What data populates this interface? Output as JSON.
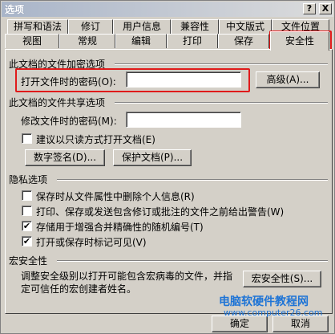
{
  "window": {
    "title": "选项",
    "help_btn": "?",
    "close_btn": "X"
  },
  "tabs_row1": [
    "拼写和语法",
    "修订",
    "用户信息",
    "兼容性",
    "中文版式",
    "文件位置"
  ],
  "tabs_row2": [
    "视图",
    "常规",
    "编辑",
    "打印",
    "保存",
    "安全性"
  ],
  "encryption": {
    "title": "此文档的文件加密选项",
    "open_password_label": "打开文件时的密码(O):",
    "open_password_value": "",
    "advanced_btn": "高级(A)..."
  },
  "sharing": {
    "title": "此文档的文件共享选项",
    "modify_password_label": "修改文件时的密码(M):",
    "modify_password_value": "",
    "readonly_label": "建议以只读方式打开文档(E)",
    "readonly_checked": false,
    "digital_signature_btn": "数字签名(D)...",
    "protect_doc_btn": "保护文档(P)..."
  },
  "privacy": {
    "title": "隐私选项",
    "items": [
      {
        "label": "保存时从文件属性中删除个人信息(R)",
        "checked": false
      },
      {
        "label": "打印、保存或发送包含修订或批注的文件之前给出警告(W)",
        "checked": false
      },
      {
        "label": "存储用于增强合并精确性的随机编号(T)",
        "checked": true
      },
      {
        "label": "打开或保存时标记可见(V)",
        "checked": true
      }
    ]
  },
  "macro": {
    "title": "宏安全性",
    "description_line1": "调整安全级别以打开可能包含宏病毒的文件，并指",
    "description_line2": "定可信任的宏创建者姓名。",
    "macro_security_btn": "宏安全性(S)..."
  },
  "footer": {
    "ok_btn": "确定",
    "cancel_btn": "取消"
  },
  "watermark": {
    "line1": "电脑软硬件教程网",
    "line2": "www.computer26.com"
  },
  "colors": {
    "highlight": "#e01b1b",
    "watermark": "#1e74d6"
  }
}
